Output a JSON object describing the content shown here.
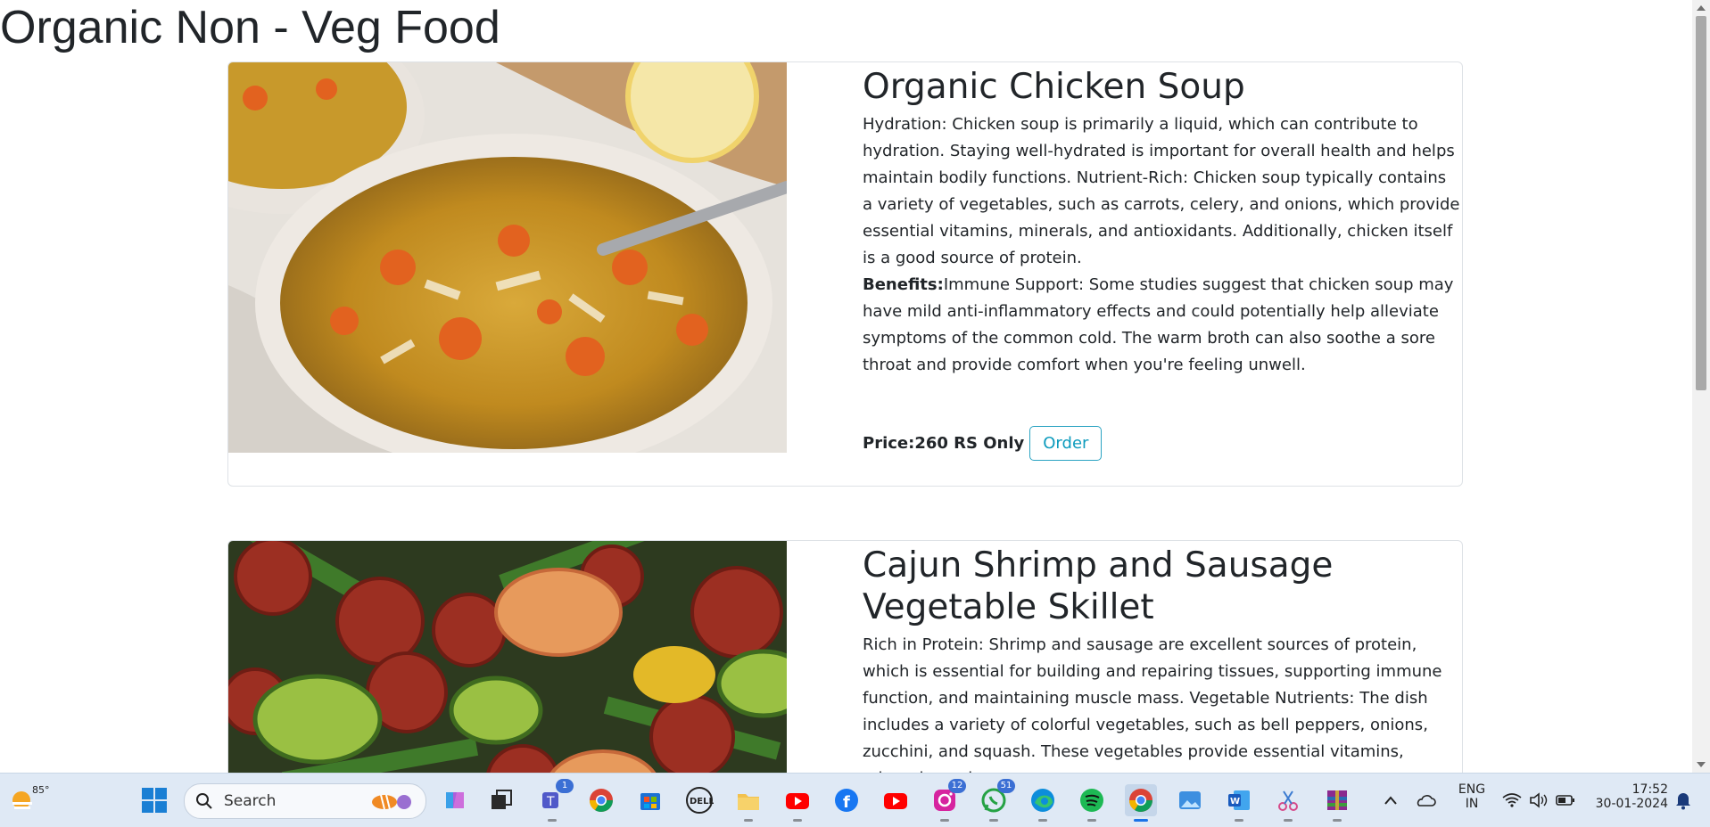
{
  "page": {
    "title": "Organic Non - Veg Food"
  },
  "items": [
    {
      "title": "Organic Chicken Soup",
      "description": "Hydration: Chicken soup is primarily a liquid, which can contribute to hydration. Staying well-hydrated is important for overall health and helps maintain bodily functions. Nutrient-Rich: Chicken soup typically contains a variety of vegetables, such as carrots, celery, and onions, which provide essential vitamins, minerals, and antioxidants. Additionally, chicken itself is a good source of protein.",
      "benefits_label": "Benefits:",
      "benefits_text": "Immune Support: Some studies suggest that chicken soup may have mild anti-inflammatory effects and could potentially help alleviate symptoms of the common cold. The warm broth can also soothe a sore throat and provide comfort when you're feeling unwell.",
      "price": "Price:260 RS Only",
      "order_label": "Order"
    },
    {
      "title": "Cajun Shrimp and Sausage Vegetable Skillet",
      "description": "Rich in Protein: Shrimp and sausage are excellent sources of protein, which is essential for building and repairing tissues, supporting immune function, and maintaining muscle mass. Vegetable Nutrients: The dish includes a variety of colorful vegetables, such as bell peppers, onions, zucchini, and squash. These vegetables provide essential vitamins, minerals, and"
    }
  ],
  "taskbar": {
    "weather_temp": "85°",
    "search_label": "Search",
    "badges": {
      "teams": "1",
      "instagram": "12",
      "whatsapp": "51"
    },
    "language": "ENG",
    "region": "IN",
    "time": "17:52",
    "date": "30-01-2024"
  },
  "colors": {
    "accent": "#0d9bbd",
    "text": "#212529",
    "taskbar": "#dfe9f5"
  }
}
